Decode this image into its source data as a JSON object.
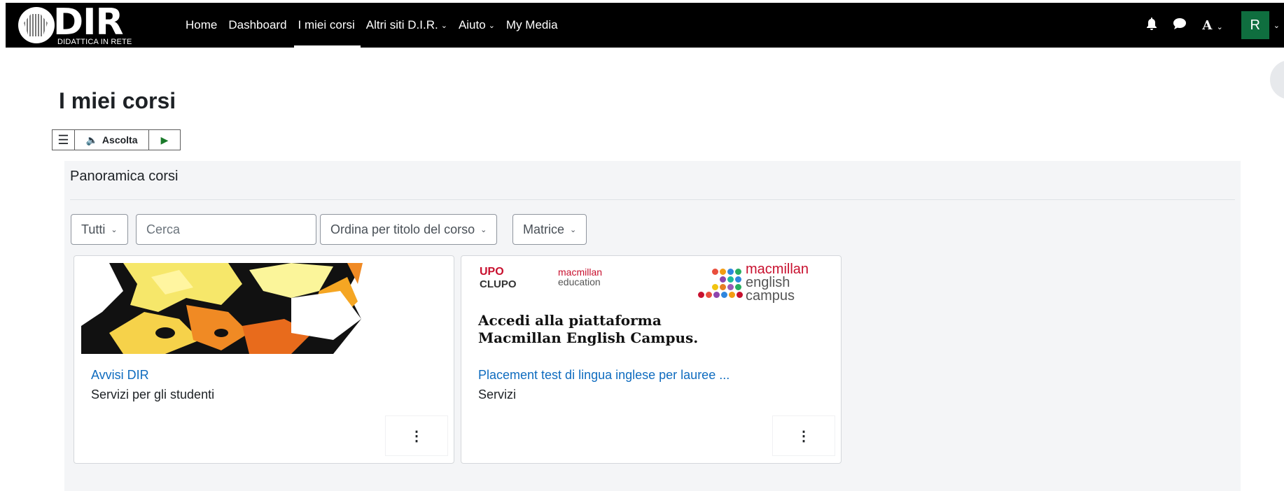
{
  "logo": {
    "text": "DIR",
    "subtext": "DIDATTICA IN RETE"
  },
  "nav": {
    "items": [
      {
        "label": "Home",
        "dropdown": false,
        "active": false
      },
      {
        "label": "Dashboard",
        "dropdown": false,
        "active": false
      },
      {
        "label": "I miei corsi",
        "dropdown": false,
        "active": true
      },
      {
        "label": "Altri siti D.I.R.",
        "dropdown": true,
        "active": false
      },
      {
        "label": "Aiuto",
        "dropdown": true,
        "active": false
      },
      {
        "label": "My Media",
        "dropdown": false,
        "active": false
      }
    ],
    "right": {
      "notifications_icon": "bell-icon",
      "messages_icon": "chat-bubble-icon",
      "language_label": "A",
      "avatar_initial": "R"
    }
  },
  "page": {
    "title": "I miei corsi"
  },
  "readspeaker": {
    "menu_icon": "hamburger-icon",
    "listen_label": "Ascolta",
    "play_icon": "play-icon"
  },
  "block": {
    "title": "Panoramica corsi",
    "filter_label": "Tutti",
    "search_placeholder": "Cerca",
    "sort_label": "Ordina per titolo del corso",
    "view_label": "Matrice"
  },
  "courses": [
    {
      "name": "Avvisi DIR",
      "category": "Servizi per gli studenti",
      "menu_icon": "kebab-menu-icon"
    },
    {
      "name": "Placement test di lingua inglese per lauree ...",
      "category": "Servizi",
      "menu_icon": "kebab-menu-icon",
      "banner": {
        "upo": "UPO",
        "clupo": "CLUPO",
        "mac_ed_1": "macmillan",
        "mac_ed_2": "education",
        "mec_1": "macmillan",
        "mec_2": "english",
        "mec_3": "campus",
        "headline_1": "Accedi alla piattaforma",
        "headline_2": "Macmillan English Campus."
      }
    }
  ],
  "colors": {
    "nav_bg": "#000000",
    "link": "#0f6cbf",
    "avatar": "#0f6e3f",
    "block_bg": "#f4f5f7"
  }
}
